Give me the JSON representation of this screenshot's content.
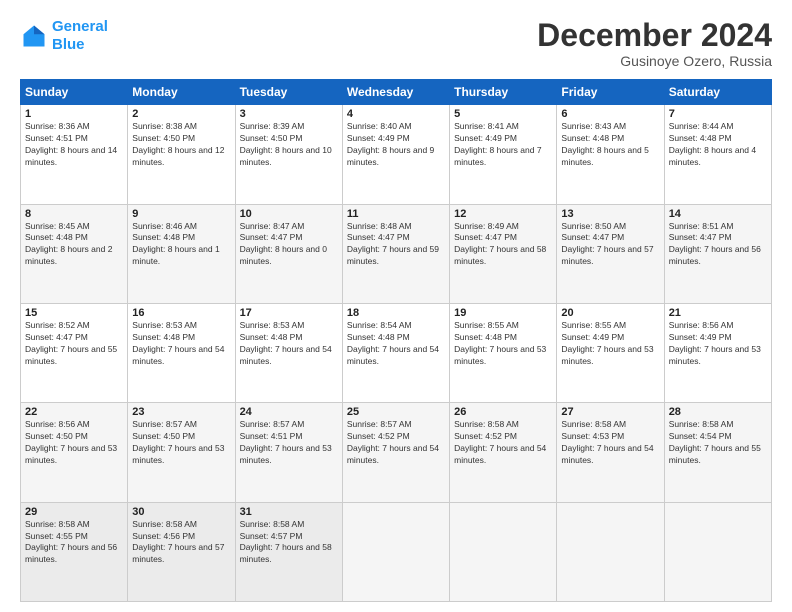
{
  "header": {
    "logo_line1": "General",
    "logo_line2": "Blue",
    "title": "December 2024",
    "subtitle": "Gusinoye Ozero, Russia"
  },
  "days_of_week": [
    "Sunday",
    "Monday",
    "Tuesday",
    "Wednesday",
    "Thursday",
    "Friday",
    "Saturday"
  ],
  "weeks": [
    [
      {
        "day": "1",
        "sunrise": "8:36 AM",
        "sunset": "4:51 PM",
        "daylight": "8 hours and 14 minutes."
      },
      {
        "day": "2",
        "sunrise": "8:38 AM",
        "sunset": "4:50 PM",
        "daylight": "8 hours and 12 minutes."
      },
      {
        "day": "3",
        "sunrise": "8:39 AM",
        "sunset": "4:50 PM",
        "daylight": "8 hours and 10 minutes."
      },
      {
        "day": "4",
        "sunrise": "8:40 AM",
        "sunset": "4:49 PM",
        "daylight": "8 hours and 9 minutes."
      },
      {
        "day": "5",
        "sunrise": "8:41 AM",
        "sunset": "4:49 PM",
        "daylight": "8 hours and 7 minutes."
      },
      {
        "day": "6",
        "sunrise": "8:43 AM",
        "sunset": "4:48 PM",
        "daylight": "8 hours and 5 minutes."
      },
      {
        "day": "7",
        "sunrise": "8:44 AM",
        "sunset": "4:48 PM",
        "daylight": "8 hours and 4 minutes."
      }
    ],
    [
      {
        "day": "8",
        "sunrise": "8:45 AM",
        "sunset": "4:48 PM",
        "daylight": "8 hours and 2 minutes."
      },
      {
        "day": "9",
        "sunrise": "8:46 AM",
        "sunset": "4:48 PM",
        "daylight": "8 hours and 1 minute."
      },
      {
        "day": "10",
        "sunrise": "8:47 AM",
        "sunset": "4:47 PM",
        "daylight": "8 hours and 0 minutes."
      },
      {
        "day": "11",
        "sunrise": "8:48 AM",
        "sunset": "4:47 PM",
        "daylight": "7 hours and 59 minutes."
      },
      {
        "day": "12",
        "sunrise": "8:49 AM",
        "sunset": "4:47 PM",
        "daylight": "7 hours and 58 minutes."
      },
      {
        "day": "13",
        "sunrise": "8:50 AM",
        "sunset": "4:47 PM",
        "daylight": "7 hours and 57 minutes."
      },
      {
        "day": "14",
        "sunrise": "8:51 AM",
        "sunset": "4:47 PM",
        "daylight": "7 hours and 56 minutes."
      }
    ],
    [
      {
        "day": "15",
        "sunrise": "8:52 AM",
        "sunset": "4:47 PM",
        "daylight": "7 hours and 55 minutes."
      },
      {
        "day": "16",
        "sunrise": "8:53 AM",
        "sunset": "4:48 PM",
        "daylight": "7 hours and 54 minutes."
      },
      {
        "day": "17",
        "sunrise": "8:53 AM",
        "sunset": "4:48 PM",
        "daylight": "7 hours and 54 minutes."
      },
      {
        "day": "18",
        "sunrise": "8:54 AM",
        "sunset": "4:48 PM",
        "daylight": "7 hours and 54 minutes."
      },
      {
        "day": "19",
        "sunrise": "8:55 AM",
        "sunset": "4:48 PM",
        "daylight": "7 hours and 53 minutes."
      },
      {
        "day": "20",
        "sunrise": "8:55 AM",
        "sunset": "4:49 PM",
        "daylight": "7 hours and 53 minutes."
      },
      {
        "day": "21",
        "sunrise": "8:56 AM",
        "sunset": "4:49 PM",
        "daylight": "7 hours and 53 minutes."
      }
    ],
    [
      {
        "day": "22",
        "sunrise": "8:56 AM",
        "sunset": "4:50 PM",
        "daylight": "7 hours and 53 minutes."
      },
      {
        "day": "23",
        "sunrise": "8:57 AM",
        "sunset": "4:50 PM",
        "daylight": "7 hours and 53 minutes."
      },
      {
        "day": "24",
        "sunrise": "8:57 AM",
        "sunset": "4:51 PM",
        "daylight": "7 hours and 53 minutes."
      },
      {
        "day": "25",
        "sunrise": "8:57 AM",
        "sunset": "4:52 PM",
        "daylight": "7 hours and 54 minutes."
      },
      {
        "day": "26",
        "sunrise": "8:58 AM",
        "sunset": "4:52 PM",
        "daylight": "7 hours and 54 minutes."
      },
      {
        "day": "27",
        "sunrise": "8:58 AM",
        "sunset": "4:53 PM",
        "daylight": "7 hours and 54 minutes."
      },
      {
        "day": "28",
        "sunrise": "8:58 AM",
        "sunset": "4:54 PM",
        "daylight": "7 hours and 55 minutes."
      }
    ],
    [
      {
        "day": "29",
        "sunrise": "8:58 AM",
        "sunset": "4:55 PM",
        "daylight": "7 hours and 56 minutes."
      },
      {
        "day": "30",
        "sunrise": "8:58 AM",
        "sunset": "4:56 PM",
        "daylight": "7 hours and 57 minutes."
      },
      {
        "day": "31",
        "sunrise": "8:58 AM",
        "sunset": "4:57 PM",
        "daylight": "7 hours and 58 minutes."
      },
      null,
      null,
      null,
      null
    ]
  ]
}
